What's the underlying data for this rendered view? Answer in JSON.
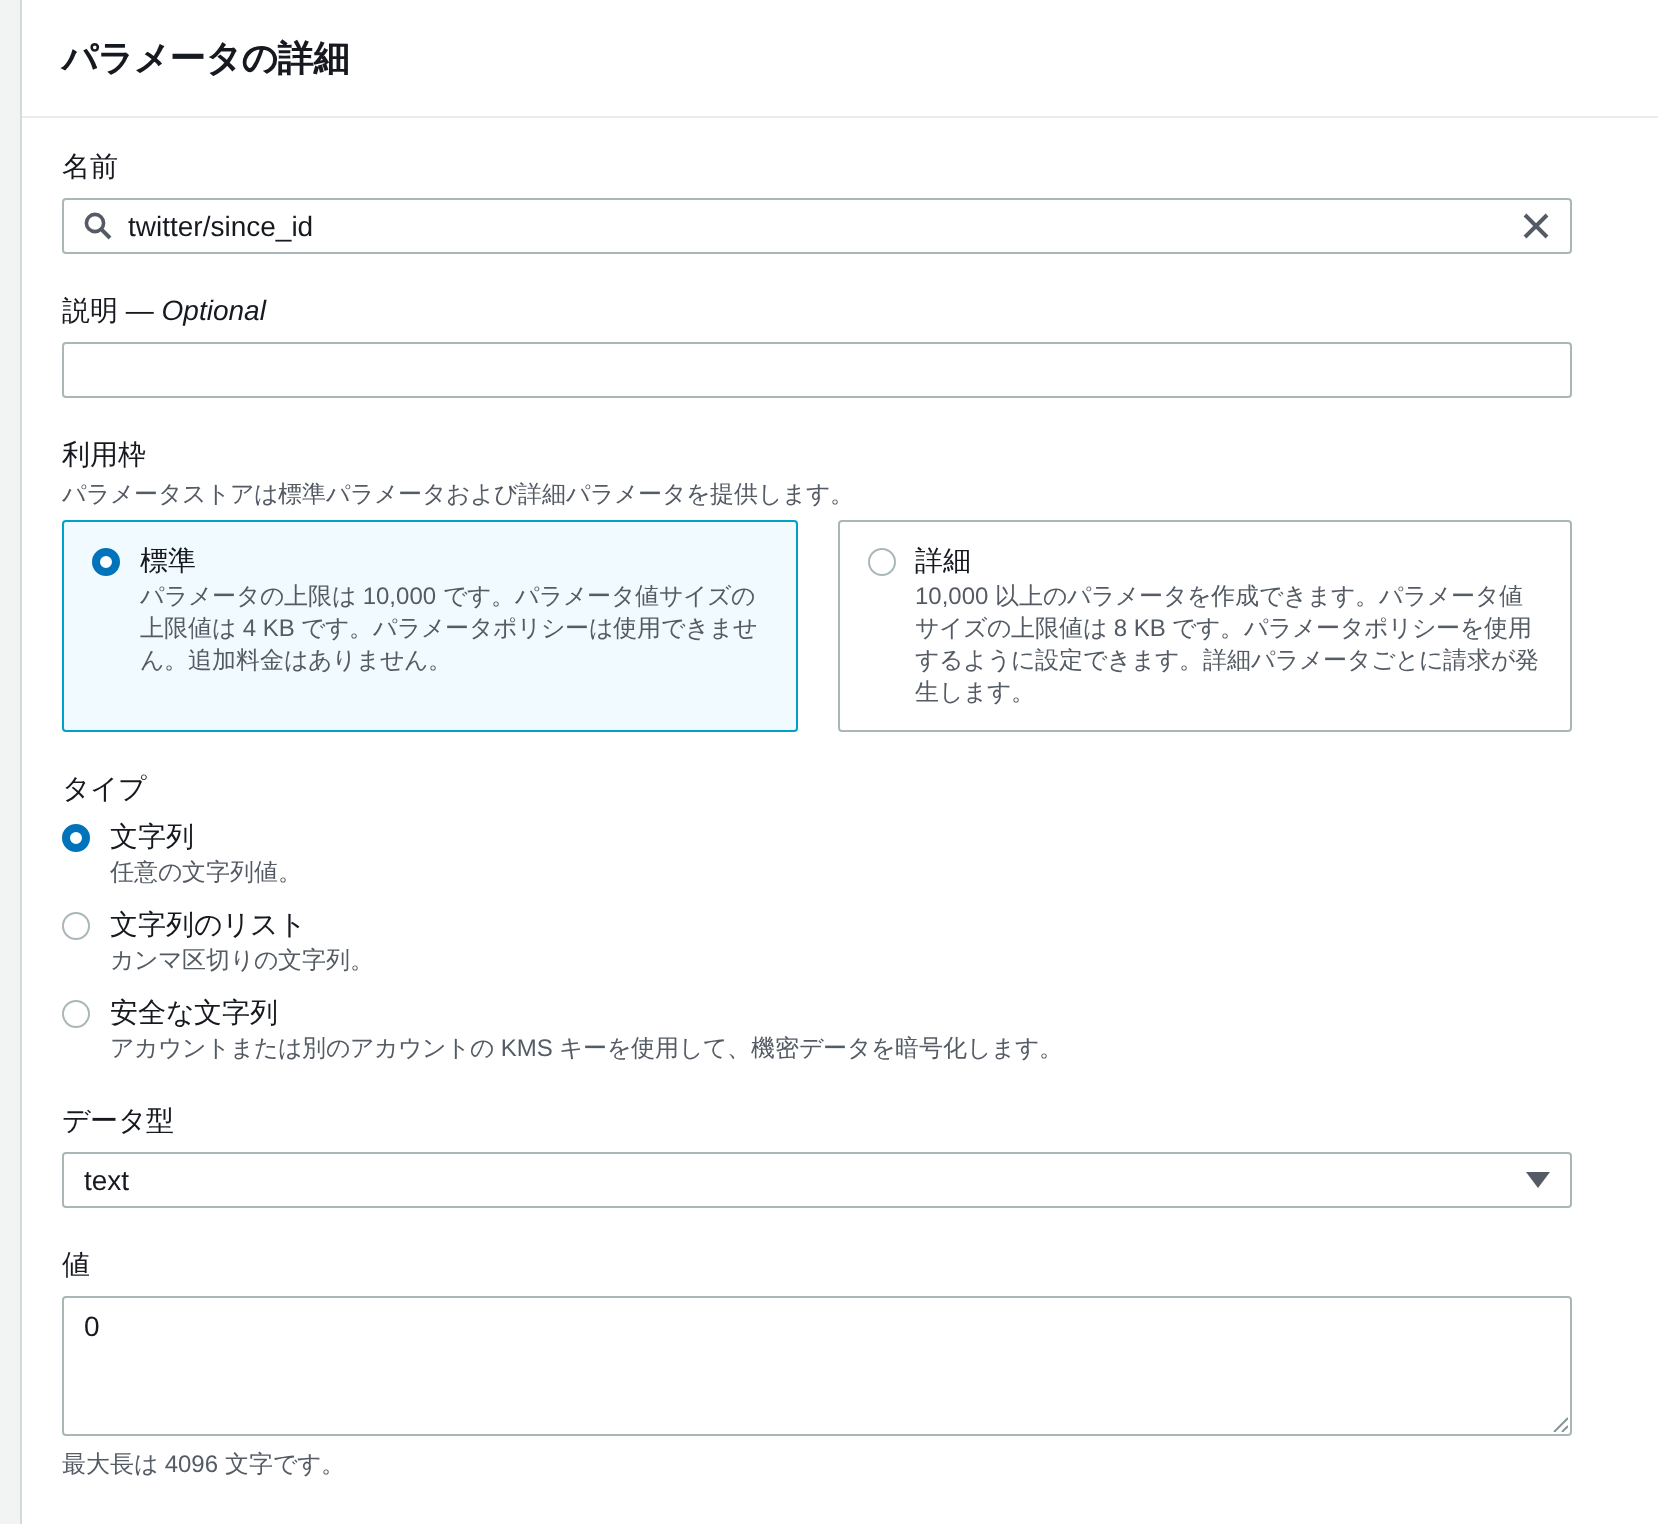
{
  "title": "パラメータの詳細",
  "name_field": {
    "label": "名前",
    "value": "twitter/since_id"
  },
  "description_field": {
    "label": "説明",
    "separator": "—",
    "optional": "Optional"
  },
  "tier": {
    "label": "利用枠",
    "description": "パラメータストアは標準パラメータおよび詳細パラメータを提供します。",
    "options": [
      {
        "title": "標準",
        "description": "パラメータの上限は 10,000 です。パラメータ値サイズの上限値は 4 KB です。パラメータポリシーは使用できません。追加料金はありません。",
        "selected": true
      },
      {
        "title": "詳細",
        "description": "10,000 以上のパラメータを作成できます。パラメータ値サイズの上限値は 8 KB です。パラメータポリシーを使用するように設定できます。詳細パラメータごとに請求が発生します。",
        "selected": false
      }
    ]
  },
  "type": {
    "label": "タイプ",
    "options": [
      {
        "title": "文字列",
        "description": "任意の文字列値。",
        "selected": true
      },
      {
        "title": "文字列のリスト",
        "description": "カンマ区切りの文字列。",
        "selected": false
      },
      {
        "title": "安全な文字列",
        "description": "アカウントまたは別のアカウントの KMS キーを使用して、機密データを暗号化します。",
        "selected": false
      }
    ]
  },
  "data_type": {
    "label": "データ型",
    "value": "text"
  },
  "value_field": {
    "label": "値",
    "value": "0",
    "hint": "最大長は 4096 文字です。"
  }
}
